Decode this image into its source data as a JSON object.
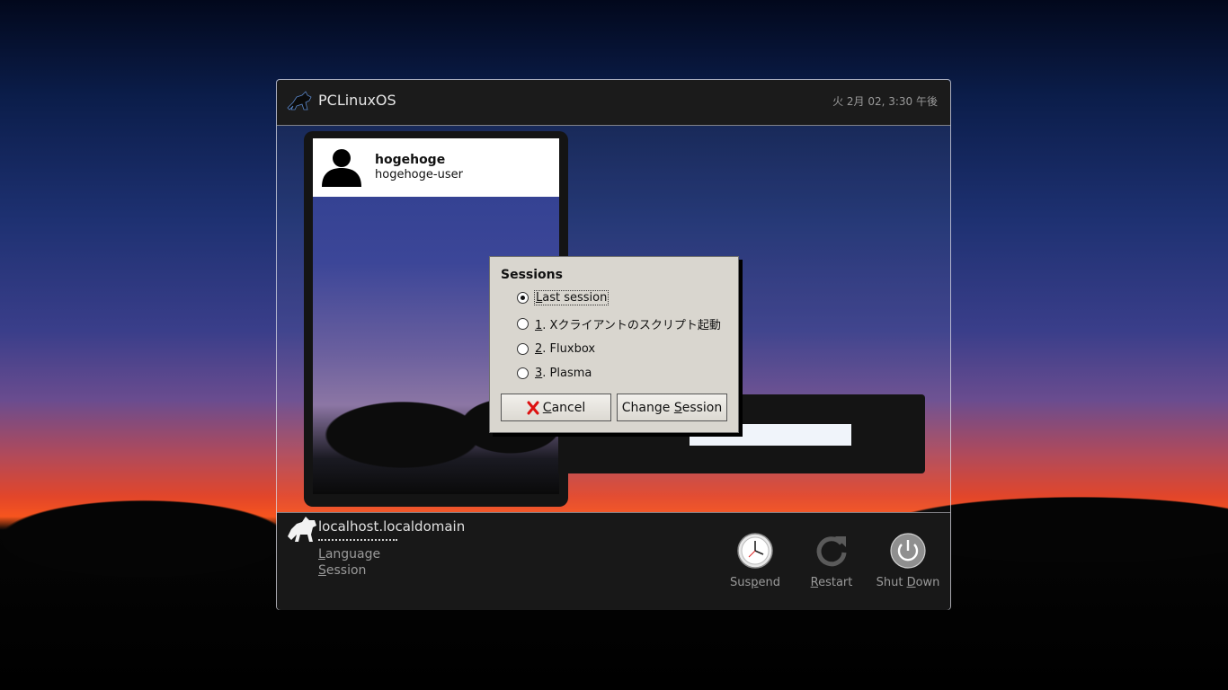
{
  "header": {
    "brand": "PCLinuxOS",
    "clock": "火  2月 02,  3:30 午後"
  },
  "users": [
    {
      "name": "hogehoge",
      "login": "hogehoge-user"
    }
  ],
  "footer": {
    "hostname": "localhost.localdomain",
    "language_prefix": "L",
    "language_rest": "anguage",
    "session_prefix": "S",
    "session_rest": "ession",
    "suspend_a": "Sus",
    "suspend_u": "p",
    "suspend_b": "end",
    "restart_u": "R",
    "restart_b": "estart",
    "shutdown_a": "Shut ",
    "shutdown_u": "D",
    "shutdown_b": "own"
  },
  "dialog": {
    "title": "Sessions",
    "options": [
      {
        "mn": "L",
        "rest": "ast session",
        "checked": true
      },
      {
        "mn": "1",
        "rest": ". Xクライアントのスクリプト起動",
        "checked": false
      },
      {
        "mn": "2",
        "rest": ". Fluxbox",
        "checked": false
      },
      {
        "mn": "3",
        "rest": ". Plasma",
        "checked": false
      }
    ],
    "cancel_u": "C",
    "cancel_rest": "ancel",
    "change_a": "Change ",
    "change_u": "S",
    "change_b": "ession"
  }
}
